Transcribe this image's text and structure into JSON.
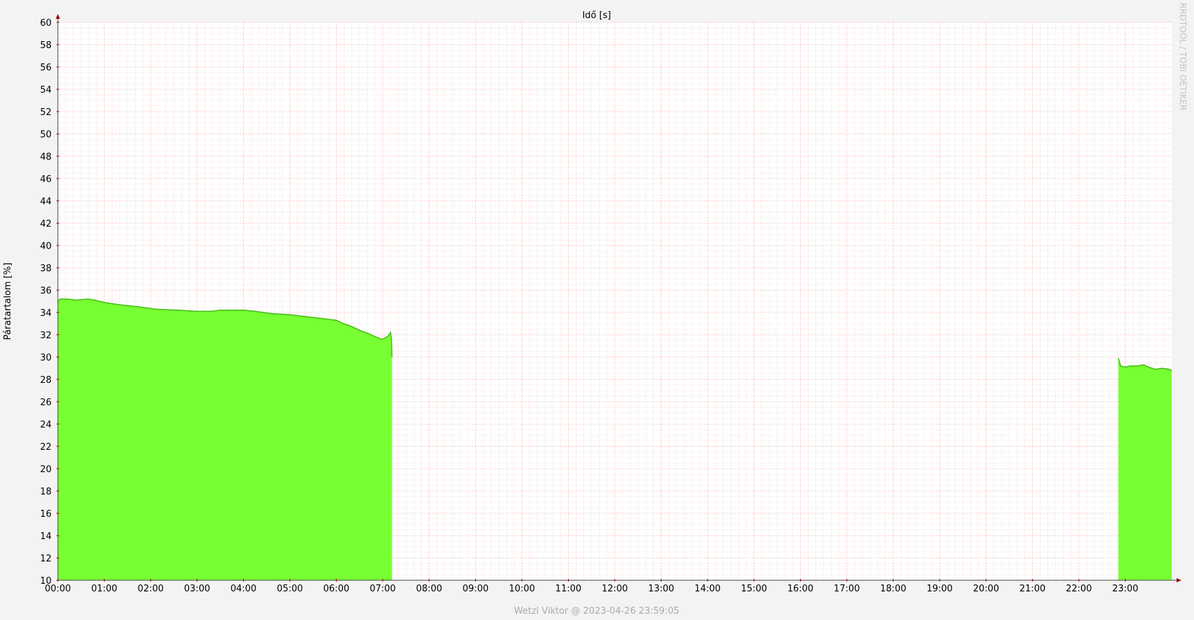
{
  "chart_data": {
    "type": "area",
    "title": "Idő [s]",
    "xlabel": "",
    "ylabel": "Páratartalom [%]",
    "footer": "Wetzl Viktor @ 2023-04-26 23:59:05",
    "watermark": "RRDTOOL / TOBI OETIKER",
    "xlim": [
      0,
      24
    ],
    "ylim": [
      10,
      60
    ],
    "x_ticks": [
      0,
      1,
      2,
      3,
      4,
      5,
      6,
      7,
      8,
      9,
      10,
      11,
      12,
      13,
      14,
      15,
      16,
      17,
      18,
      19,
      20,
      21,
      22,
      23
    ],
    "x_tick_labels": [
      "00:00",
      "01:00",
      "02:00",
      "03:00",
      "04:00",
      "05:00",
      "06:00",
      "07:00",
      "08:00",
      "09:00",
      "10:00",
      "11:00",
      "12:00",
      "13:00",
      "14:00",
      "15:00",
      "16:00",
      "17:00",
      "18:00",
      "19:00",
      "20:00",
      "21:00",
      "22:00",
      "23:00"
    ],
    "y_ticks": [
      10,
      12,
      14,
      16,
      18,
      20,
      22,
      24,
      26,
      28,
      30,
      32,
      34,
      36,
      38,
      40,
      42,
      44,
      46,
      48,
      50,
      52,
      54,
      56,
      58,
      60
    ],
    "y_tick_labels": [
      "10",
      "12",
      "14",
      "16",
      "18",
      "20",
      "22",
      "24",
      "26",
      "28",
      "30",
      "32",
      "34",
      "36",
      "38",
      "40",
      "42",
      "44",
      "46",
      "48",
      "50",
      "52",
      "54",
      "56",
      "58",
      "60"
    ],
    "grid": true,
    "colors": {
      "background": "#f3f3f3",
      "canvas": "#ffffff",
      "area_fill": "#77ff33",
      "area_line": "#44bb11",
      "major_grid": "#f2a8a8",
      "minor_grid": "#f6d4d4",
      "axis": "#444444",
      "arrow": "#990000",
      "footer_text": "#aaaaaa"
    },
    "series": [
      {
        "values": [
          [
            0.0,
            35.0
          ],
          [
            0.05,
            35.2
          ],
          [
            0.2,
            35.2
          ],
          [
            0.4,
            35.1
          ],
          [
            0.65,
            35.2
          ],
          [
            0.8,
            35.1
          ],
          [
            1.0,
            34.9
          ],
          [
            1.3,
            34.7
          ],
          [
            1.75,
            34.5
          ],
          [
            2.1,
            34.3
          ],
          [
            2.6,
            34.2
          ],
          [
            3.0,
            34.1
          ],
          [
            3.3,
            34.1
          ],
          [
            3.5,
            34.2
          ],
          [
            4.0,
            34.2
          ],
          [
            4.25,
            34.1
          ],
          [
            4.6,
            33.9
          ],
          [
            5.0,
            33.8
          ],
          [
            5.4,
            33.6
          ],
          [
            5.8,
            33.4
          ],
          [
            6.0,
            33.3
          ],
          [
            6.15,
            33.0
          ],
          [
            6.3,
            32.8
          ],
          [
            6.5,
            32.4
          ],
          [
            6.7,
            32.1
          ],
          [
            6.85,
            31.8
          ],
          [
            6.98,
            31.6
          ],
          [
            7.05,
            31.7
          ],
          [
            7.12,
            31.9
          ],
          [
            7.17,
            32.2
          ],
          [
            7.19,
            31.5
          ],
          [
            7.2,
            30.0
          ]
        ]
      },
      {
        "values": [
          [
            22.85,
            29.9
          ],
          [
            22.9,
            29.2
          ],
          [
            23.0,
            29.1
          ],
          [
            23.1,
            29.2
          ],
          [
            23.25,
            29.2
          ],
          [
            23.4,
            29.3
          ],
          [
            23.5,
            29.1
          ],
          [
            23.65,
            28.9
          ],
          [
            23.8,
            29.0
          ],
          [
            23.95,
            28.9
          ],
          [
            24.0,
            28.8
          ]
        ]
      }
    ]
  }
}
